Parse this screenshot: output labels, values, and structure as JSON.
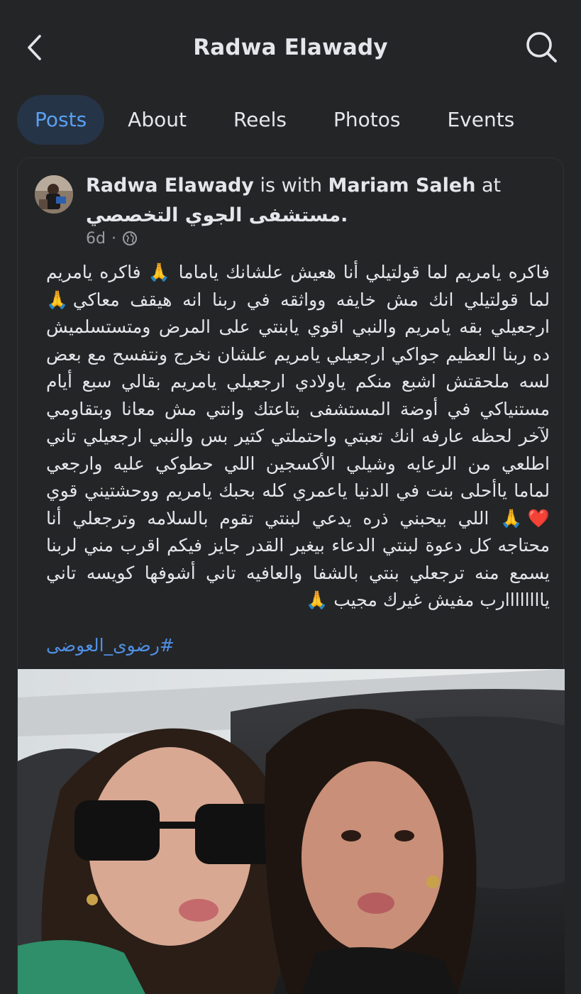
{
  "header": {
    "title": "Radwa Elawady",
    "back_icon": "chevron-left-icon",
    "search_icon": "search-icon"
  },
  "tabs": [
    {
      "label": "Posts",
      "active": true
    },
    {
      "label": "About",
      "active": false
    },
    {
      "label": "Reels",
      "active": false
    },
    {
      "label": "Photos",
      "active": false
    },
    {
      "label": "Events",
      "active": false
    }
  ],
  "post": {
    "author": "Radwa Elawady",
    "with_text": "is with",
    "tagged": "Mariam Saleh",
    "at_text": "at",
    "place": "مستشفى الجوي التخصصي.",
    "time": "6d",
    "separator": "·",
    "privacy_icon": "globe-icon",
    "body": "فاكره يامريم لما قولتيلي أنا هعيش علشانك ياماما 🙏 فاكره يامريم لما قولتيلي انك مش خايفه وواثقه في ربنا انه هيقف معاكي🙏 ارجعيلي بقه يامريم  والنبي اقوي يابنتي على المرض ومتستسلميش ده ربنا العظيم جواكي ارجعيلي يامريم علشان نخرج ونتفسح مع بعض لسه ملحقتش اشبع منكم ياولادي ارجعيلي يامريم بقالي سبع أيام مستنياكي في أوضة المستشفى بتاعتك وانتي مش معانا وبتقاومي لآخر لحظه عارفه انك تعبتي واحتملتي كتير بس والنبي ارجعيلي تاني اطلعي من الرعايه وشيلي الأكسجين اللي حطوكي عليه وارجعي لماما ياأحلى بنت في الدنيا ياعمري كله بحبك يامريم ووحشتيني قوي ❤️🙏 اللي بيحبني ذره يدعي لبنتي تقوم بالسلامه وترجعلي أنا محتاجه كل دعوة لبنتي الدعاء بيغير القدر جايز فيكم اقرب مني لربنا يسمع منه ترجعلي بنتي بالشفا والعافيه تاني أشوفها كويسه تاني ياااااااارب مفيش غيرك مجيب 🙏",
    "hashtag": "#رضوى_العوضى",
    "colors": {
      "background": "#242527",
      "text": "#e4e6eb",
      "muted": "#9a9ca1",
      "link": "#4f8fe3",
      "active_tab_bg": "#263447",
      "active_tab_text": "#5aa0f0"
    }
  }
}
